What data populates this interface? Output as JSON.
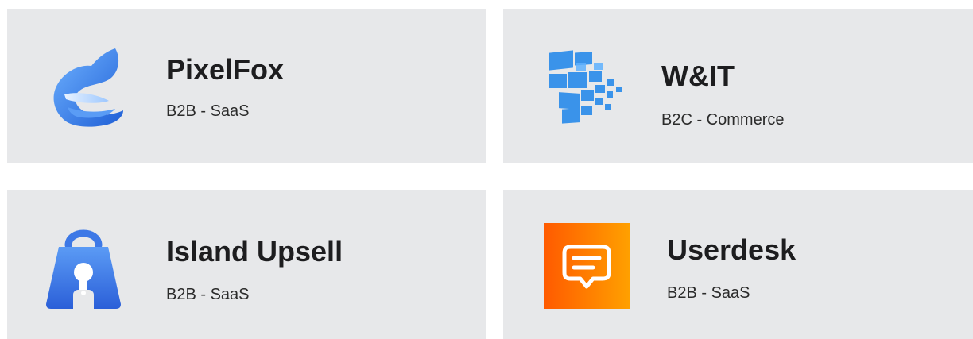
{
  "companies": [
    {
      "name": "PixelFox",
      "category": "B2B - SaaS",
      "logo_icon": "fox-logo-icon",
      "accent_color": "#3b82f6"
    },
    {
      "name": "W&IT",
      "category": "B2C - Commerce",
      "logo_icon": "tiles-logo-icon",
      "accent_color": "#2d8ce6"
    },
    {
      "name": "Island Upsell",
      "category": "B2B - SaaS",
      "logo_icon": "shopping-bag-logo-icon",
      "accent_color": "#3b6fe0"
    },
    {
      "name": "Userdesk",
      "category": "B2B - SaaS",
      "logo_icon": "chat-bubble-logo-icon",
      "accent_color": "#ff6a00"
    }
  ]
}
